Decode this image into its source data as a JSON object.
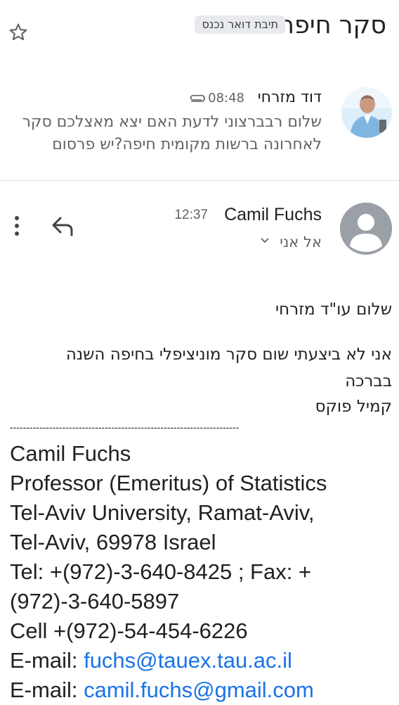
{
  "header": {
    "title": "סקר חיפה",
    "label": "תיבת דואר נכנס"
  },
  "messages": [
    {
      "sender": "דוד מזרחי",
      "time": "08:48",
      "snippet": "שלום רבברצוני לדעת האם יצא מאצלכם סקר לאחרונה ברשות מקומית חיפה?יש פרסום"
    },
    {
      "sender": "Camil Fuchs",
      "time": "12:37",
      "to": "אל אני",
      "body": {
        "greeting": "שלום עו\"ד מזרחי",
        "text": "אני לא ביצעתי שום סקר מוניציפלי בחיפה השנה",
        "closing": "בברכה",
        "signoff": "קמיל פוקס",
        "separator": "----------------------------------------------------------------------"
      },
      "signature": {
        "name": "Camil Fuchs",
        "title": "Professor (Emeritus) of Statistics",
        "address1": "Tel-Aviv University, Ramat-Aviv,",
        "address2": "Tel-Aviv, 69978 Israel",
        "tel_line1": "Tel: +(972)-3-640-8425 ; Fax: +",
        "tel_line2": "(972)-3-640-5897",
        "cell": "Cell  +(972)-54-454-6226",
        "email_label": "E-mail:",
        "email1": "fuchs@tauex.tau.ac.il",
        "email2": "camil.fuchs@gmail.com"
      }
    }
  ],
  "colors": {
    "link": "#1a73e8",
    "label_arrow": "#1a73e8",
    "muted": "#5f6368"
  }
}
